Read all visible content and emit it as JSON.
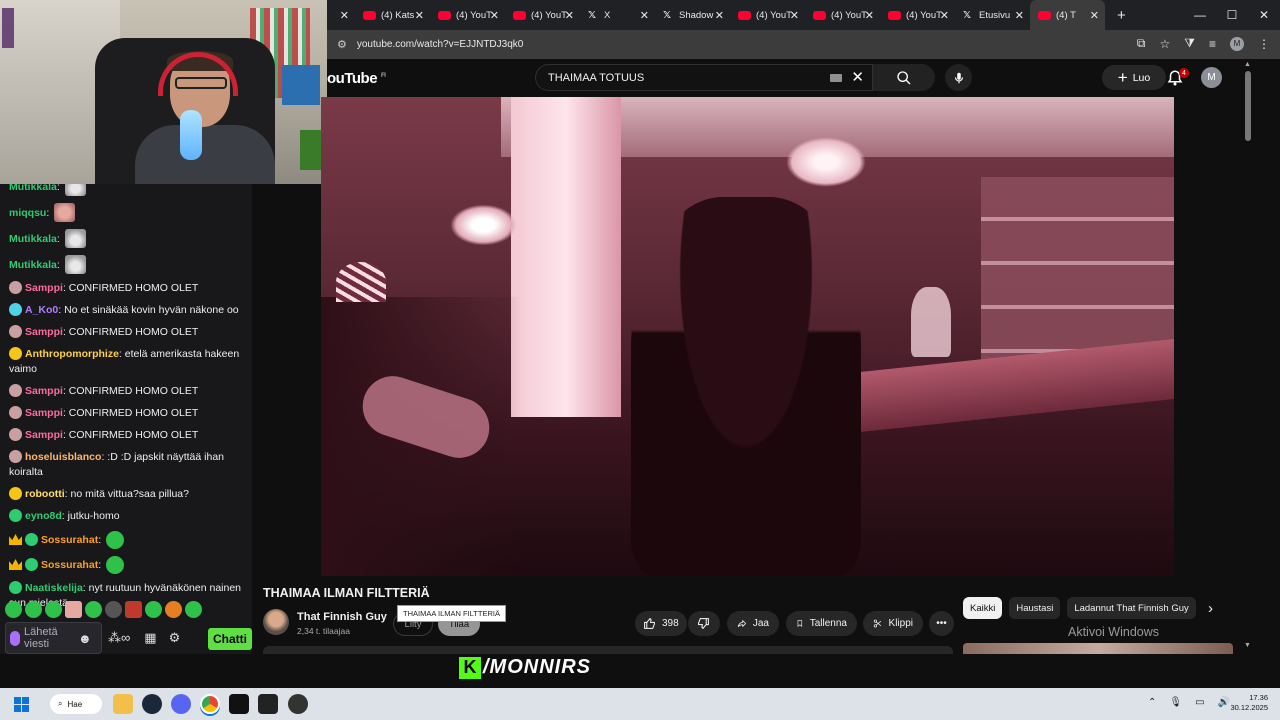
{
  "browser": {
    "tabs": [
      {
        "title": "",
        "favicon": "x-icon"
      },
      {
        "title": "(4) Kats",
        "favicon": "youtube-icon"
      },
      {
        "title": "(4) YouT",
        "favicon": "youtube-icon"
      },
      {
        "title": "(4) YouT",
        "favicon": "youtube-icon"
      },
      {
        "title": "X",
        "favicon": "x-icon"
      },
      {
        "title": "Shadow",
        "favicon": "x-icon"
      },
      {
        "title": "(4) YouT",
        "favicon": "youtube-icon"
      },
      {
        "title": "(4) YouT",
        "favicon": "youtube-icon"
      },
      {
        "title": "(4) YouT",
        "favicon": "youtube-icon"
      },
      {
        "title": "Etusivu",
        "favicon": "x-icon"
      },
      {
        "title": "(4) T",
        "favicon": "youtube-icon",
        "active": true
      }
    ],
    "url": "youtube.com/watch?v=EJJNTDJ3qk0"
  },
  "youtube": {
    "logo": "ouTube",
    "region": "FI",
    "search_value": "THAIMAA TOTUUS",
    "create_label": "Luo",
    "notification_count": "4",
    "avatar_letter": "M",
    "video_title": "THAIMAA ILMAN FILTTERIÄ",
    "tooltip": "THAIMAA ILMAN FILTTERIÄ",
    "channel_name": "That Finnish Guy",
    "subscribers": "2,34 t. tilaajaa",
    "join_label": "Liity",
    "subscribe_label": "Tilaa",
    "likes": "398",
    "share_label": "Jaa",
    "save_label": "Tallenna",
    "clip_label": "Klippi",
    "chips": [
      "Kaikki",
      "Haustasi",
      "Ladannut That Finnish Guy"
    ],
    "activate_windows": "Aktivoi Windows"
  },
  "chat": {
    "messages": [
      {
        "user": "Mutikkala",
        "color": "#2ecc71",
        "text": "",
        "emote": "cat"
      },
      {
        "user": "miqqsu",
        "color": "#2ecc71",
        "text": "",
        "emote": "face"
      },
      {
        "user": "Mutikkala",
        "color": "#2ecc71",
        "text": "",
        "emote": "cat"
      },
      {
        "user": "Mutikkala",
        "color": "#2ecc71",
        "text": "",
        "emote": "cat"
      },
      {
        "user": "Samppi",
        "color": "#ff6b9d",
        "text": "CONFIRMED HOMO OLET",
        "badge": "#c9a0a0"
      },
      {
        "user": "A_Ko0",
        "color": "#b37cff",
        "text": "No et sinäkää kovin hyvän näkone oo",
        "badge": "#4fd1e8"
      },
      {
        "user": "Samppi",
        "color": "#ff6b9d",
        "text": "CONFIRMED HOMO OLET",
        "badge": "#c9a0a0"
      },
      {
        "user": "Anthropomorphize",
        "color": "#ffd23f",
        "text": "etelä amerikasta hakeen vaimo",
        "badge": "#f5c518"
      },
      {
        "user": "Samppi",
        "color": "#ff6b9d",
        "text": "CONFIRMED HOMO OLET",
        "badge": "#c9a0a0"
      },
      {
        "user": "Samppi",
        "color": "#ff6b9d",
        "text": "CONFIRMED HOMO OLET",
        "badge": "#c9a0a0"
      },
      {
        "user": "Samppi",
        "color": "#ff6b9d",
        "text": "CONFIRMED HOMO OLET",
        "badge": "#c9a0a0"
      },
      {
        "user": "hoseluisblanco",
        "color": "#ffb86b",
        "text": ":D :D japskit näyttää ihan koiralta",
        "badge": "#c9a0a0"
      },
      {
        "user": "robootti",
        "color": "#ffe066",
        "text": "no mitä vittua?saa pillua?",
        "badge": "#f5c518"
      },
      {
        "user": "eyno8d",
        "color": "#2ecc71",
        "text": "jutku-homo",
        "badge": "#2ecc71"
      },
      {
        "user": "Sossurahat",
        "color": "#ff9f1c",
        "text": "",
        "badge": "#2ecc71",
        "crown": true,
        "emote": "green"
      },
      {
        "user": "Sossurahat",
        "color": "#ff9f1c",
        "text": "",
        "badge": "#2ecc71",
        "crown": true,
        "emote": "green"
      },
      {
        "user": "Naatiskelija",
        "color": "#2ecc71",
        "text": "nyt ruutuun hyvänäkönen nainen sun mielestä",
        "badge": "#2ecc71"
      }
    ],
    "input_placeholder": "Lähetä viesti",
    "send_label": "Chatti"
  },
  "overlay": {
    "brand": "/MONNIRS",
    "logo_letter": "K"
  },
  "taskbar": {
    "search_label": "Hae",
    "time": "17.36",
    "date": "30.12.2025"
  },
  "colors": {
    "kick_green": "#53fc18",
    "youtube_red": "#ff0033"
  }
}
